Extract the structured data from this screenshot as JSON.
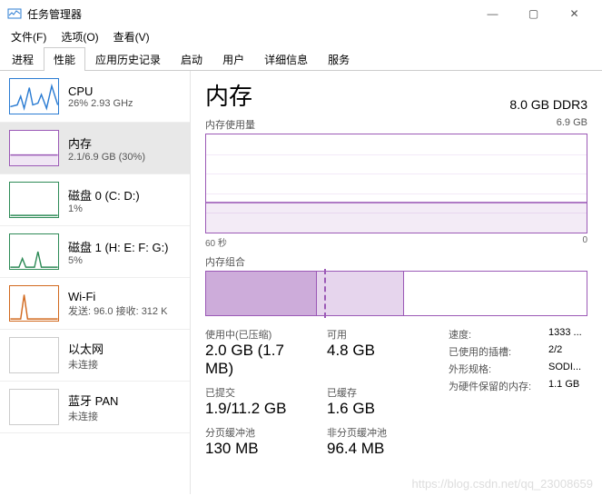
{
  "window": {
    "title": "任务管理器",
    "minimize": "—",
    "maximize": "▢",
    "close": "✕"
  },
  "menu": [
    "文件(F)",
    "选项(O)",
    "查看(V)"
  ],
  "tabs": [
    "进程",
    "性能",
    "应用历史记录",
    "启动",
    "用户",
    "详细信息",
    "服务"
  ],
  "activeTab": 1,
  "sidebar": [
    {
      "title": "CPU",
      "sub": "26% 2.93 GHz",
      "color": "#2b7cd3"
    },
    {
      "title": "内存",
      "sub": "2.1/6.9 GB (30%)",
      "color": "#9b59b6",
      "active": true
    },
    {
      "title": "磁盘 0 (C: D:)",
      "sub": "1%",
      "color": "#2e8b57"
    },
    {
      "title": "磁盘 1 (H: E: F: G:)",
      "sub": "5%",
      "color": "#2e8b57"
    },
    {
      "title": "Wi-Fi",
      "sub": "发送: 96.0 接收: 312 K",
      "color": "#d2691e"
    },
    {
      "title": "以太网",
      "sub": "未连接",
      "color": "#ccc"
    },
    {
      "title": "蓝牙 PAN",
      "sub": "未连接",
      "color": "#ccc"
    }
  ],
  "main": {
    "title": "内存",
    "capacity": "8.0 GB DDR3",
    "usage": {
      "label": "内存使用量",
      "max": "6.9 GB"
    },
    "axis": {
      "left": "60 秒",
      "right": "0"
    },
    "composition": {
      "label": "内存组合"
    },
    "stats": {
      "inuse": {
        "label": "使用中(已压缩)",
        "value": "2.0 GB (1.7 MB)"
      },
      "available": {
        "label": "可用",
        "value": "4.8 GB"
      },
      "committed": {
        "label": "已提交",
        "value": "1.9/11.2 GB"
      },
      "cached": {
        "label": "已缓存",
        "value": "1.6 GB"
      },
      "paged": {
        "label": "分页缓冲池",
        "value": "130 MB"
      },
      "nonpaged": {
        "label": "非分页缓冲池",
        "value": "96.4 MB"
      }
    },
    "specs": {
      "speed": {
        "label": "速度:",
        "value": "1333 ..."
      },
      "slots": {
        "label": "已使用的插槽:",
        "value": "2/2"
      },
      "form": {
        "label": "外形规格:",
        "value": "SODI..."
      },
      "hw": {
        "label": "为硬件保留的内存:",
        "value": "1.1 GB"
      }
    }
  },
  "chart_data": {
    "type": "line",
    "title": "内存使用量",
    "ylabel": "GB",
    "ylim": [
      0,
      6.9
    ],
    "xrange_seconds": 60,
    "x": [
      60,
      55,
      50,
      45,
      40,
      35,
      30,
      25,
      20,
      15,
      10,
      5,
      0
    ],
    "values": [
      2.15,
      2.14,
      2.12,
      2.12,
      2.1,
      2.08,
      2.06,
      2.06,
      2.08,
      2.08,
      2.1,
      2.1,
      2.1
    ]
  },
  "watermark": "https://blog.csdn.net/qq_23008659"
}
